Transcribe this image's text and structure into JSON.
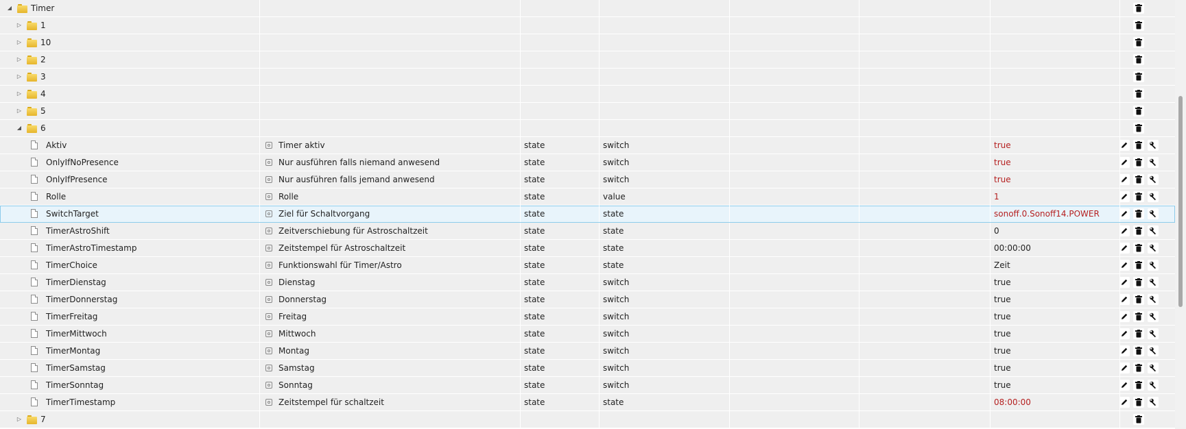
{
  "colors": {
    "row_bg": "#efefef",
    "selected_bg": "#e8f4fb",
    "selected_border": "#8ccbea",
    "value_red": "#b52020",
    "folder": "#f0c84a"
  },
  "icons": {
    "folder": "folder-icon",
    "file": "file-icon",
    "role": "role-icon",
    "edit": "pencil-icon",
    "delete": "trash-icon",
    "settings": "wrench-icon",
    "expanded": "triangle-down-icon",
    "collapsed": "triangle-right-icon"
  },
  "tree": {
    "root": {
      "label": "Timer",
      "expanded": true
    },
    "folders_before": [
      "1",
      "10",
      "2",
      "3",
      "4",
      "5"
    ],
    "open_folder": {
      "label": "6",
      "expanded": true
    },
    "states": [
      {
        "id": "Aktiv",
        "name": "Timer aktiv",
        "type": "state",
        "role": "switch",
        "value": "true",
        "value_red": true
      },
      {
        "id": "OnlyIfNoPresence",
        "name": "Nur ausführen falls niemand anwesend",
        "type": "state",
        "role": "switch",
        "value": "true",
        "value_red": true
      },
      {
        "id": "OnlyIfPresence",
        "name": "Nur ausführen falls jemand anwesend",
        "type": "state",
        "role": "switch",
        "value": "true",
        "value_red": true
      },
      {
        "id": "Rolle",
        "name": "Rolle",
        "type": "state",
        "role": "value",
        "value": "1",
        "value_red": true
      },
      {
        "id": "SwitchTarget",
        "name": "Ziel für Schaltvorgang",
        "type": "state",
        "role": "state",
        "value": "sonoff.0.Sonoff14.POWER",
        "value_red": true,
        "selected": true
      },
      {
        "id": "TimerAstroShift",
        "name": "Zeitverschiebung für Astroschaltzeit",
        "type": "state",
        "role": "state",
        "value": "0",
        "value_red": false
      },
      {
        "id": "TimerAstroTimestamp",
        "name": "Zeitstempel für Astroschaltzeit",
        "type": "state",
        "role": "state",
        "value": "00:00:00",
        "value_red": false
      },
      {
        "id": "TimerChoice",
        "name": "Funktionswahl für Timer/Astro",
        "type": "state",
        "role": "state",
        "value": "Zeit",
        "value_red": false
      },
      {
        "id": "TimerDienstag",
        "name": "Dienstag",
        "type": "state",
        "role": "switch",
        "value": "true",
        "value_red": false
      },
      {
        "id": "TimerDonnerstag",
        "name": "Donnerstag",
        "type": "state",
        "role": "switch",
        "value": "true",
        "value_red": false
      },
      {
        "id": "TimerFreitag",
        "name": "Freitag",
        "type": "state",
        "role": "switch",
        "value": "true",
        "value_red": false
      },
      {
        "id": "TimerMittwoch",
        "name": "Mittwoch",
        "type": "state",
        "role": "switch",
        "value": "true",
        "value_red": false
      },
      {
        "id": "TimerMontag",
        "name": "Montag",
        "type": "state",
        "role": "switch",
        "value": "true",
        "value_red": false
      },
      {
        "id": "TimerSamstag",
        "name": "Samstag",
        "type": "state",
        "role": "switch",
        "value": "true",
        "value_red": false
      },
      {
        "id": "TimerSonntag",
        "name": "Sonntag",
        "type": "state",
        "role": "switch",
        "value": "true",
        "value_red": false
      },
      {
        "id": "TimerTimestamp",
        "name": "Zeitstempel für schaltzeit",
        "type": "state",
        "role": "state",
        "value": "08:00:00",
        "value_red": true
      }
    ],
    "folders_after": [
      "7"
    ]
  }
}
